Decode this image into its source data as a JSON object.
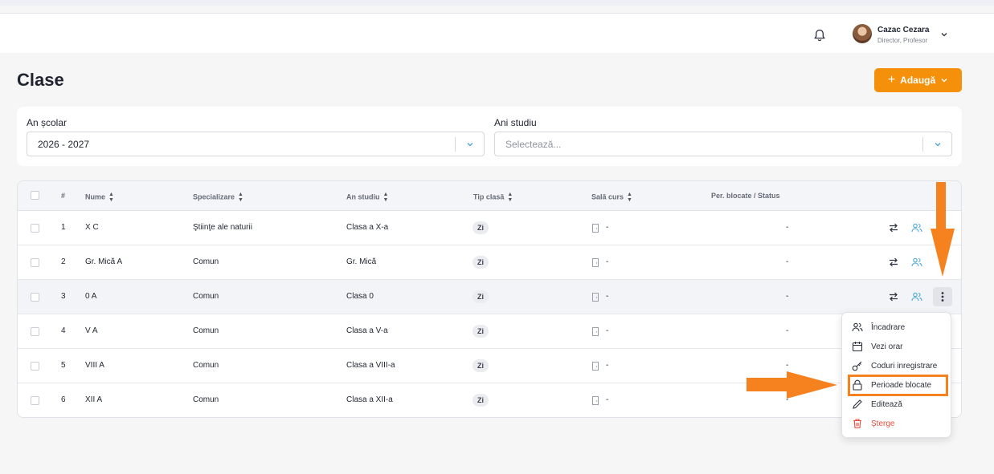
{
  "user": {
    "name": "Cazac Cezara",
    "role": "Director, Profesor"
  },
  "page": {
    "title": "Clase",
    "add_label": "Adaugă"
  },
  "filters": {
    "school_year_label": "An școlar",
    "school_year_value": "2026 - 2027",
    "study_years_label": "Ani studiu",
    "study_years_placeholder": "Selectează..."
  },
  "table": {
    "columns": [
      "#",
      "Nume",
      "Specializare",
      "An studiu",
      "Tip clasă",
      "Sală curs",
      "Per. blocate / Status"
    ],
    "rows": [
      {
        "num": "1",
        "name": "X C",
        "spec": "Ştiinţe ale naturii",
        "year": "Clasa a X-a",
        "type": "Zi",
        "room": "-",
        "status": "-"
      },
      {
        "num": "2",
        "name": "Gr. Mică A",
        "spec": "Comun",
        "year": "Gr. Mică",
        "type": "Zi",
        "room": "-",
        "status": "-"
      },
      {
        "num": "3",
        "name": "0 A",
        "spec": "Comun",
        "year": "Clasa 0",
        "type": "Zi",
        "room": "-",
        "status": "-"
      },
      {
        "num": "4",
        "name": "V A",
        "spec": "Comun",
        "year": "Clasa a V-a",
        "type": "Zi",
        "room": "-",
        "status": "-"
      },
      {
        "num": "5",
        "name": "VIII A",
        "spec": "Comun",
        "year": "Clasa a VIII-a",
        "type": "Zi",
        "room": "-",
        "status": "-"
      },
      {
        "num": "6",
        "name": "XII A",
        "spec": "Comun",
        "year": "Clasa a XII-a",
        "type": "Zi",
        "room": "-",
        "status": "-"
      }
    ]
  },
  "menu": {
    "items": [
      "Încadrare",
      "Vezi orar",
      "Coduri inregistrare",
      "Perioade blocate",
      "Editează",
      "Șterge"
    ]
  },
  "colors": {
    "accent": "#f5900b",
    "highlight": "#f5821f",
    "danger": "#e74c3c",
    "link_icon": "#4aa8d8"
  },
  "icons": [
    "bell-icon",
    "chevron-down-icon",
    "plus-icon",
    "transfer-icon",
    "users-icon",
    "kebab-icon",
    "lock-icon",
    "calendar-icon",
    "key-icon",
    "pencil-icon",
    "trash-icon"
  ]
}
